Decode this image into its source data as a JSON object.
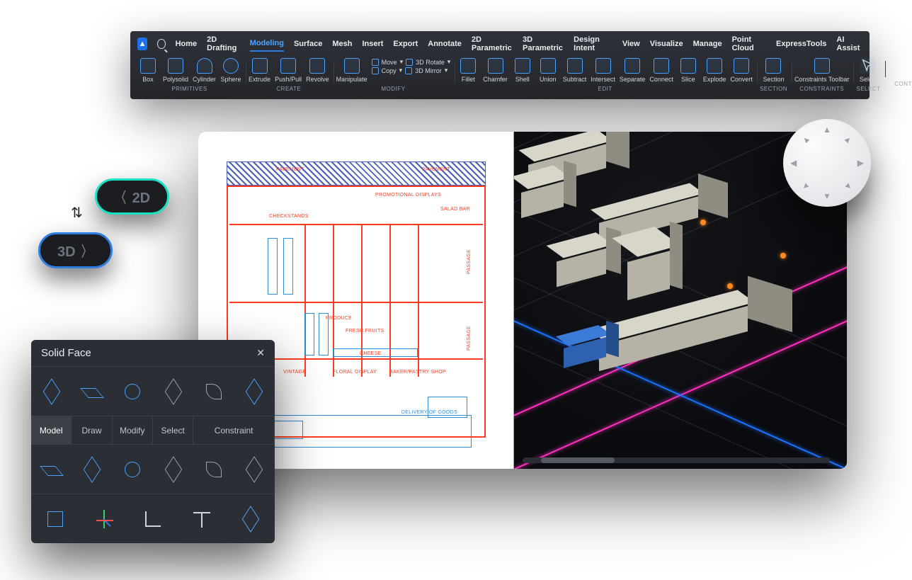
{
  "menu": {
    "items": [
      "Home",
      "2D Drafting",
      "Modeling",
      "Surface",
      "Mesh",
      "Insert",
      "Export",
      "Annotate",
      "2D Parametric",
      "3D Parametric",
      "Design Intent",
      "View",
      "Visualize",
      "Manage",
      "Point Cloud",
      "ExpressTools",
      "AI Assist"
    ],
    "active_index": 2
  },
  "ribbon": {
    "groups": [
      {
        "label": "PRIMITIVES",
        "buttons": [
          "Box",
          "Polysolid",
          "Cylinder",
          "Sphere"
        ]
      },
      {
        "label": "CREATE",
        "buttons": [
          "Extrude",
          "Push/Pull",
          "Revolve"
        ]
      },
      {
        "label": "MODIFY",
        "buttons": [
          "Manipulate"
        ],
        "mini": [
          "Move",
          "3D Rotate",
          "Copy",
          "3D Mirror"
        ]
      },
      {
        "label": "EDIT",
        "buttons": [
          "Fillet",
          "Chamfer",
          "Shell",
          "Union",
          "Subtract",
          "Intersect",
          "Separate",
          "Connect",
          "Slice",
          "Explode",
          "Convert"
        ]
      },
      {
        "label": "SECTION",
        "buttons": [
          "Section"
        ]
      },
      {
        "label": "CONSTRAINTS",
        "buttons": [
          "Constraints Toolbar"
        ]
      },
      {
        "label": "SELECT",
        "buttons": [
          "Select"
        ]
      },
      {
        "label": "CONTROLS",
        "buttons": []
      }
    ]
  },
  "palette": {
    "title": "Solid Face",
    "tabs": [
      "Model",
      "Draw",
      "Modify",
      "Select",
      "Constraint"
    ],
    "active_tab": 0
  },
  "pills": {
    "two_d": "2D",
    "three_d": "3D"
  },
  "plan_labels": {
    "pavement_left": "PAVEMENT",
    "pavement_right": "PAVEMENT",
    "checkstands": "CHECKSTANDS",
    "promo": "PROMOTIONAL DISPLAYS",
    "salad": "SALAD BAR",
    "passage_right": "PASSAGE",
    "passage_bottom": "PASSAGE",
    "vintage": "VINTAGE",
    "floral": "FLORAL DISPLAY",
    "bakery": "BAKER/PASTRY SHOP",
    "produce": "PRODUCE",
    "cheese": "CHEESE",
    "fruits": "FRESH FRUITS",
    "delivery": "DELIVERY OF GOODS"
  }
}
